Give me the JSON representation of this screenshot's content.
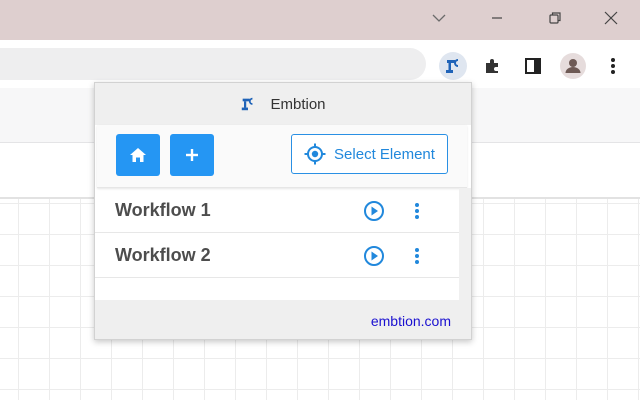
{
  "browser": {
    "window_controls": {
      "minimize_icon": "chevron-down-icon",
      "restore_icon": "restore-icon",
      "close_icon": "close-icon"
    },
    "toolbar_icons": [
      "embtion-extension-icon",
      "puzzle-icon",
      "side-panel-icon",
      "profile-avatar-icon",
      "kebab-menu-icon"
    ]
  },
  "popup": {
    "title": "Embtion",
    "actions": {
      "home_icon": "home-icon",
      "add_icon": "plus-icon",
      "select_label": "Select Element",
      "select_icon": "crosshair-icon"
    },
    "workflows": [
      {
        "name": "Workflow 1"
      },
      {
        "name": "Workflow 2"
      }
    ],
    "footer_link": "embtion.com"
  },
  "colors": {
    "accent": "#2596f3",
    "titlebar": "#decfcf",
    "link": "#1a10d0"
  }
}
